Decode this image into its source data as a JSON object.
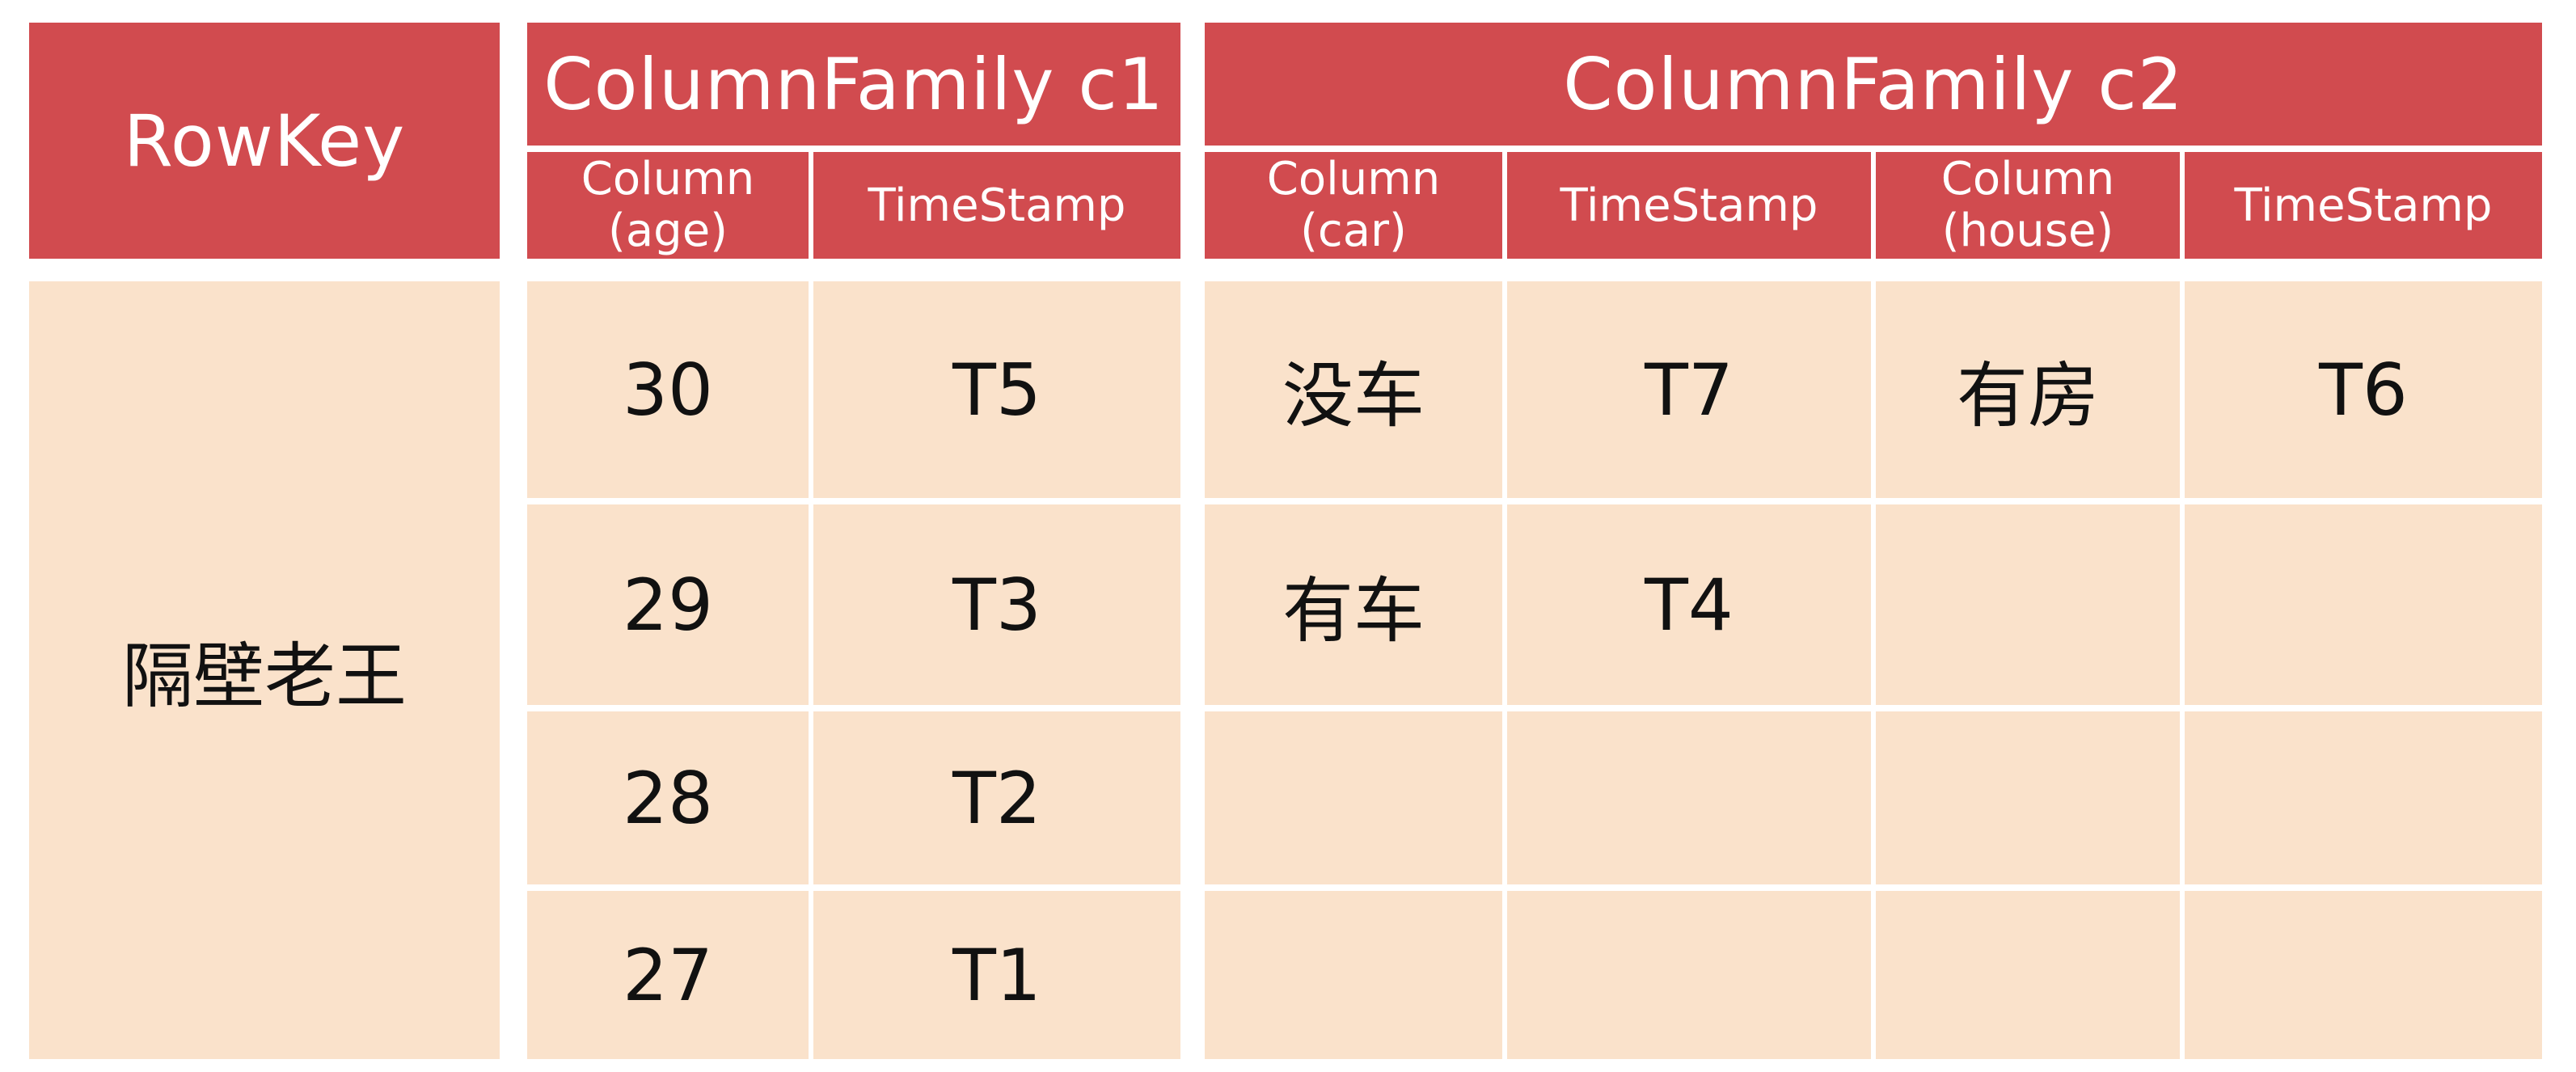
{
  "table": {
    "rowkey_header": "RowKey",
    "family_c1": "ColumnFamily c1",
    "family_c2": "ColumnFamily c2",
    "c1_col1": {
      "line1": "Column",
      "line2": "(age)"
    },
    "c1_col2": "TimeStamp",
    "c2_col1": {
      "line1": "Column",
      "line2": "(car)"
    },
    "c2_col2": "TimeStamp",
    "c2_col3": {
      "line1": "Column",
      "line2": "(house)"
    },
    "c2_col4": "TimeStamp",
    "rowkey_value": "隔壁老王",
    "rows": [
      {
        "age": "30",
        "age_ts": "T5",
        "car": "没车",
        "car_ts": "T7",
        "house": "有房",
        "house_ts": "T6"
      },
      {
        "age": "29",
        "age_ts": "T3",
        "car": "有车",
        "car_ts": "T4",
        "house": "",
        "house_ts": ""
      },
      {
        "age": "28",
        "age_ts": "T2",
        "car": "",
        "car_ts": "",
        "house": "",
        "house_ts": ""
      },
      {
        "age": "27",
        "age_ts": "T1",
        "car": "",
        "car_ts": "",
        "house": "",
        "house_ts": ""
      }
    ],
    "colors": {
      "header": "#d14b4f",
      "cell": "#fae2cb"
    }
  }
}
